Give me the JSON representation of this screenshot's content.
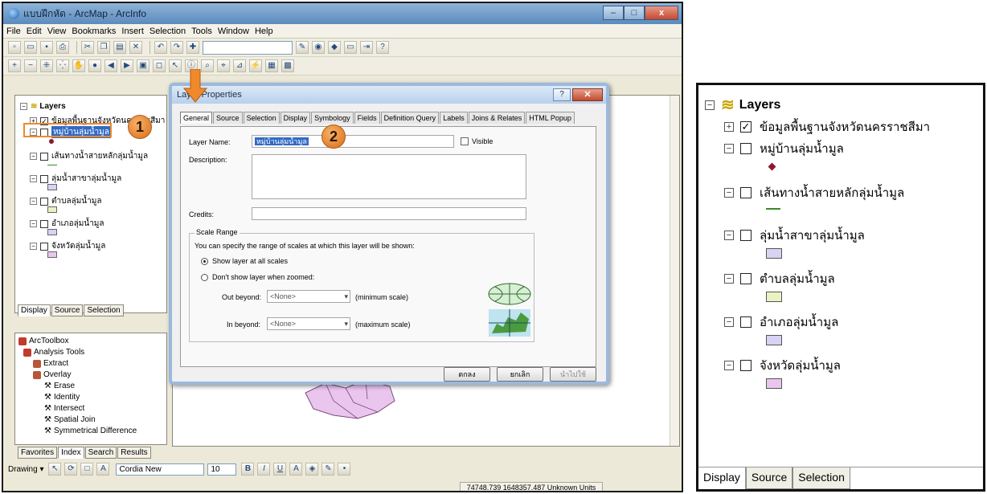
{
  "window": {
    "title": "แบบฝึกหัด - ArcMap - ArcInfo",
    "controls": {
      "minimize": "–",
      "maximize": "□",
      "close": "x"
    }
  },
  "menu": [
    "File",
    "Edit",
    "View",
    "Bookmarks",
    "Insert",
    "Selection",
    "Tools",
    "Window",
    "Help"
  ],
  "toc": {
    "root": "Layers",
    "layers": [
      {
        "label": "ข้อมูลพื้นฐานจังหวัดนครราชสีมา",
        "checked": true,
        "expander": "+"
      },
      {
        "label": "หมู่บ้านลุ่มน้ำมูล",
        "checked": false,
        "expander": "−",
        "selected": true
      },
      {
        "label": "เส้นทางน้ำสายหลักลุ่มน้ำมูล",
        "checked": false,
        "expander": "−"
      },
      {
        "label": "ลุ่มน้ำสาขาลุ่มน้ำมูล",
        "checked": false,
        "expander": "−"
      },
      {
        "label": "ตำบลลุ่มน้ำมูล",
        "checked": false,
        "expander": "−"
      },
      {
        "label": "อำเภอลุ่มน้ำมูล",
        "checked": false,
        "expander": "−"
      },
      {
        "label": "จังหวัดลุ่มน้ำมูล",
        "checked": false,
        "expander": "−"
      }
    ],
    "tabs": [
      "Display",
      "Source",
      "Selection"
    ]
  },
  "toolbox": {
    "root": "ArcToolbox",
    "items": [
      "Analysis Tools",
      "Extract",
      "Overlay",
      "Erase",
      "Identity",
      "Intersect",
      "Spatial Join",
      "Symmetrical Difference"
    ],
    "tabs": [
      "Favorites",
      "Index",
      "Search",
      "Results"
    ]
  },
  "drawing": {
    "label": "Drawing ▾",
    "font": "Cordia New",
    "size": "10"
  },
  "status": {
    "coords": "74748.739  1648357.487 Unknown Units"
  },
  "dialog": {
    "title": "Layer Properties",
    "tabs": [
      "General",
      "Source",
      "Selection",
      "Display",
      "Symbology",
      "Fields",
      "Definition Query",
      "Labels",
      "Joins & Relates",
      "HTML Popup"
    ],
    "layer_name_label": "Layer Name:",
    "layer_name_value": "หมู่บ้านลุ่มน้ำมูล",
    "visible_label": "Visible",
    "description_label": "Description:",
    "credits_label": "Credits:",
    "scale_range_title": "Scale Range",
    "scale_range_text": "You can specify the range of scales at which this layer will be shown:",
    "show_all_label": "Show layer at all scales",
    "dont_show_label": "Don't show layer when zoomed:",
    "out_beyond_label": "Out beyond:",
    "out_beyond_value": "<None>",
    "min_scale_label": "(minimum scale)",
    "in_beyond_label": "In beyond:",
    "in_beyond_value": "<None>",
    "max_scale_label": "(maximum scale)",
    "ok_label": "ตกลง",
    "cancel_label": "ยกเลิก",
    "apply_label": "นำไปใช้"
  },
  "callouts": [
    "1",
    "2"
  ],
  "zoom_toc": {
    "root": "Layers",
    "layers": [
      {
        "label": "ข้อมูลพื้นฐานจังหวัดนครราชสีมา",
        "checked": true,
        "expander": "+"
      },
      {
        "label": "หมู่บ้านลุ่มน้ำมูล",
        "checked": false,
        "expander": "−"
      },
      {
        "label": "เส้นทางน้ำสายหลักลุ่มน้ำมูล",
        "checked": false,
        "expander": "−"
      },
      {
        "label": "ลุ่มน้ำสาขาลุ่มน้ำมูล",
        "checked": false,
        "expander": "−"
      },
      {
        "label": "ตำบลลุ่มน้ำมูล",
        "checked": false,
        "expander": "−"
      },
      {
        "label": "อำเภอลุ่มน้ำมูล",
        "checked": false,
        "expander": "−"
      },
      {
        "label": "จังหวัดลุ่มน้ำมูล",
        "checked": false,
        "expander": "−"
      }
    ],
    "tabs": [
      "Display",
      "Source",
      "Selection"
    ]
  },
  "colors": {
    "point_symbol": "#8b1a2c",
    "line_symbol": "#3a8a2a",
    "subbasin_fill": "#d9d2f2",
    "tambon_fill": "#eaf2c4",
    "amphoe_fill": "#d9d2f2",
    "province_fill": "#eac6ee",
    "callout_orange": "#f0892c"
  }
}
